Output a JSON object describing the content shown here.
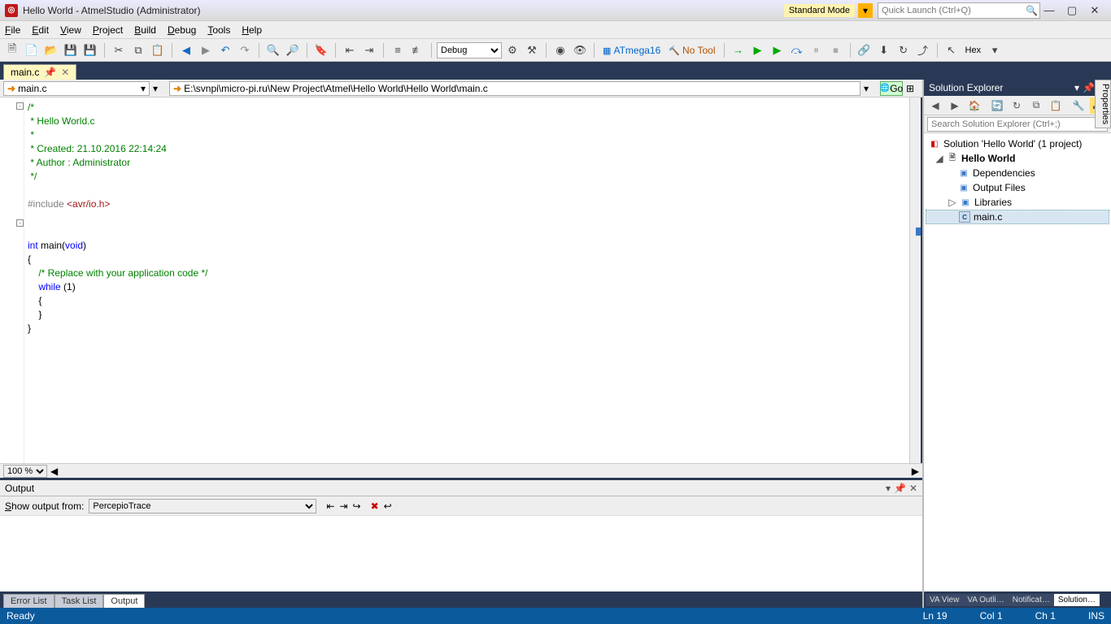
{
  "titlebar": {
    "title": "Hello World - AtmelStudio (Administrator)",
    "mode_label": "Standard Mode",
    "quick_launch_placeholder": "Quick Launch (Ctrl+Q)"
  },
  "menu": {
    "file": "File",
    "edit": "Edit",
    "view": "View",
    "project": "Project",
    "build": "Build",
    "debug": "Debug",
    "tools": "Tools",
    "help": "Help"
  },
  "toolbar": {
    "config_selected": "Debug",
    "device_label": "ATmega16",
    "tool_label": "No Tool",
    "hex_label": "Hex"
  },
  "doc_tab": {
    "label": "main.c"
  },
  "navbar": {
    "scope": "main.c",
    "path": "E:\\svnpi\\micro-pi.ru\\New Project\\Atmel\\Hello World\\Hello World\\main.c",
    "go": "Go"
  },
  "code": {
    "l1": "/*",
    "l2": " * Hello World.c",
    "l3": " *",
    "l4": " * Created: 21.10.2016 22:14:24",
    "l5": " * Author : Administrator",
    "l6": " */",
    "l7": "",
    "l8a": "#include",
    "l8b": " <avr/io.h>",
    "l9": "",
    "l10": "",
    "l11a": "int",
    "l11b": " main(",
    "l11c": "void",
    "l11d": ")",
    "l12": "{",
    "l13a": "    ",
    "l13b": "/* Replace with your application code */",
    "l14a": "    ",
    "l14b": "while",
    "l14c": " (1)",
    "l15": "    {",
    "l16": "    }",
    "l17": "}"
  },
  "zoom": {
    "value": "100 %"
  },
  "output": {
    "panel_title": "Output",
    "show_from_label": "Show output from:",
    "source_selected": "PercepioTrace",
    "tabs": {
      "error_list": "Error List",
      "task_list": "Task List",
      "output": "Output"
    }
  },
  "solution_explorer": {
    "title": "Solution Explorer",
    "search_placeholder": "Search Solution Explorer (Ctrl+;)",
    "root": "Solution 'Hello World' (1 project)",
    "project": "Hello World",
    "dependencies": "Dependencies",
    "output_files": "Output Files",
    "libraries": "Libraries",
    "mainc": "main.c",
    "tabs": {
      "va_view": "VA View",
      "va_outline": "VA Outli…",
      "notifications": "Notificat…",
      "solution": "Solution…"
    }
  },
  "properties_tab": "Properties",
  "status": {
    "ready": "Ready",
    "ln": "Ln 19",
    "col": "Col 1",
    "ch": "Ch 1",
    "ins": "INS"
  }
}
